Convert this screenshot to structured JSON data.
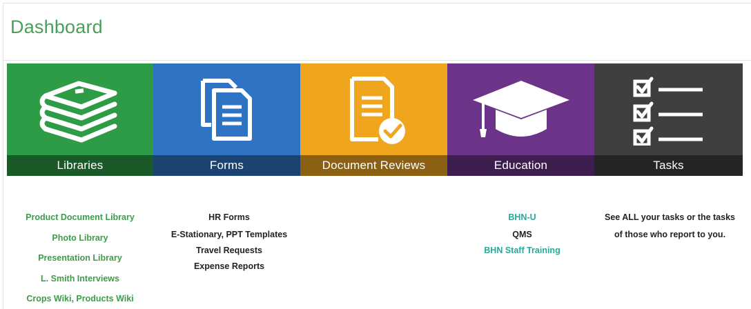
{
  "header": {
    "title": "Dashboard"
  },
  "colors": {
    "title": "#4a9e5c",
    "link_green": "#3e9b4a",
    "link_teal": "#2aa898",
    "text_dark": "#222222"
  },
  "tiles": [
    {
      "label": "Libraries",
      "color": "#2e9b46",
      "icon": "books-icon"
    },
    {
      "label": "Forms",
      "color": "#2f74c4",
      "icon": "documents-icon"
    },
    {
      "label": "Document Reviews",
      "color": "#f0a51f",
      "icon": "document-check-icon"
    },
    {
      "label": "Education",
      "color": "#6b3488",
      "icon": "graduation-cap-icon"
    },
    {
      "label": "Tasks",
      "color": "#3f3f3f",
      "icon": "checklist-icon"
    }
  ],
  "libraries_links": [
    "Product Document Library",
    "Photo Library",
    "Presentation Library",
    "L. Smith Interviews",
    "Crops Wiki, Products Wiki"
  ],
  "forms_links": [
    "HR Forms",
    "E-Stationary, PPT Templates",
    "Travel Requests",
    "Expense Reports"
  ],
  "education_links": [
    "BHN-U",
    "QMS",
    "BHN Staff Training"
  ],
  "tasks_text": [
    "See ALL your tasks or the tasks",
    "of those who report to you."
  ]
}
